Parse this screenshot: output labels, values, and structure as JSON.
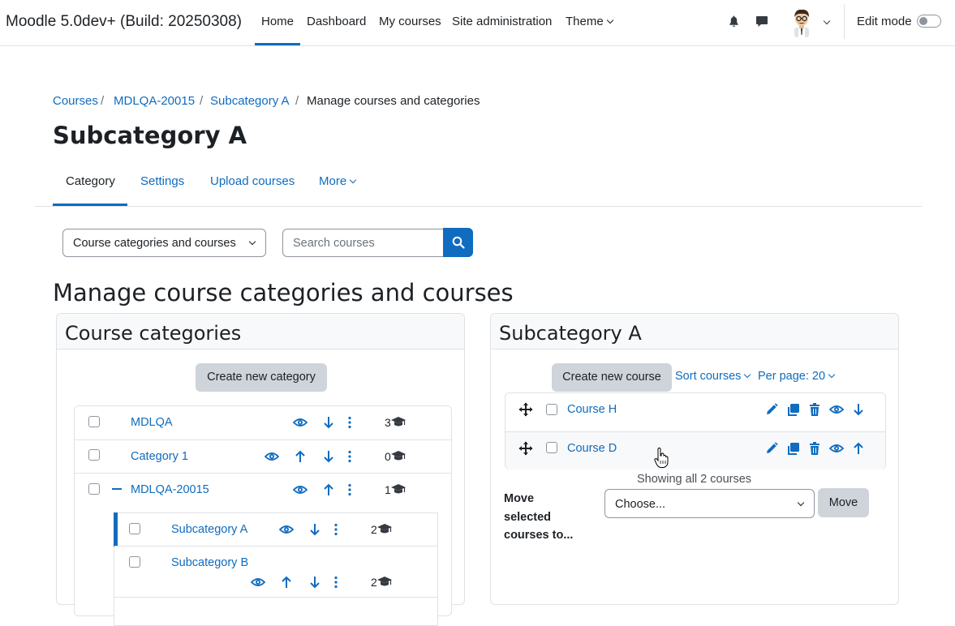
{
  "topbar": {
    "site_name": "Moodle 5.0dev+ (Build: 20250308)",
    "nav": [
      "Home",
      "Dashboard",
      "My courses",
      "Site administration",
      "Theme"
    ],
    "edit_mode_label": "Edit mode"
  },
  "breadcrumb": [
    "Courses",
    "MDLQA-20015",
    "Subcategory A",
    "Manage courses and categories"
  ],
  "page_title": "Subcategory A",
  "secondary_nav": [
    "Category",
    "Settings",
    "Upload courses",
    "More"
  ],
  "view_select": "Course categories and courses",
  "search": {
    "placeholder": "Search courses"
  },
  "heading": "Manage course categories and courses",
  "categories_panel": {
    "title": "Course categories",
    "create_label": "Create new category",
    "rows": [
      {
        "name": "MDLQA",
        "count": "3"
      },
      {
        "name": "Category 1",
        "count": "0"
      },
      {
        "name": "MDLQA-20015",
        "count": "1"
      },
      {
        "name": "Subcategory A",
        "count": "2"
      },
      {
        "name": "Subcategory B",
        "count": "2"
      }
    ]
  },
  "courses_panel": {
    "title": "Subcategory A",
    "create_label": "Create new course",
    "sort_label": "Sort courses",
    "per_page_label": "Per page: 20",
    "courses": [
      {
        "name": "Course H"
      },
      {
        "name": "Course D"
      }
    ],
    "showing": "Showing all 2 courses",
    "move_label": "Move selected courses to...",
    "move_select": "Choose...",
    "move_button": "Move"
  },
  "colors": {
    "accent": "#0f6cbf",
    "button_grey": "#ced4da"
  }
}
